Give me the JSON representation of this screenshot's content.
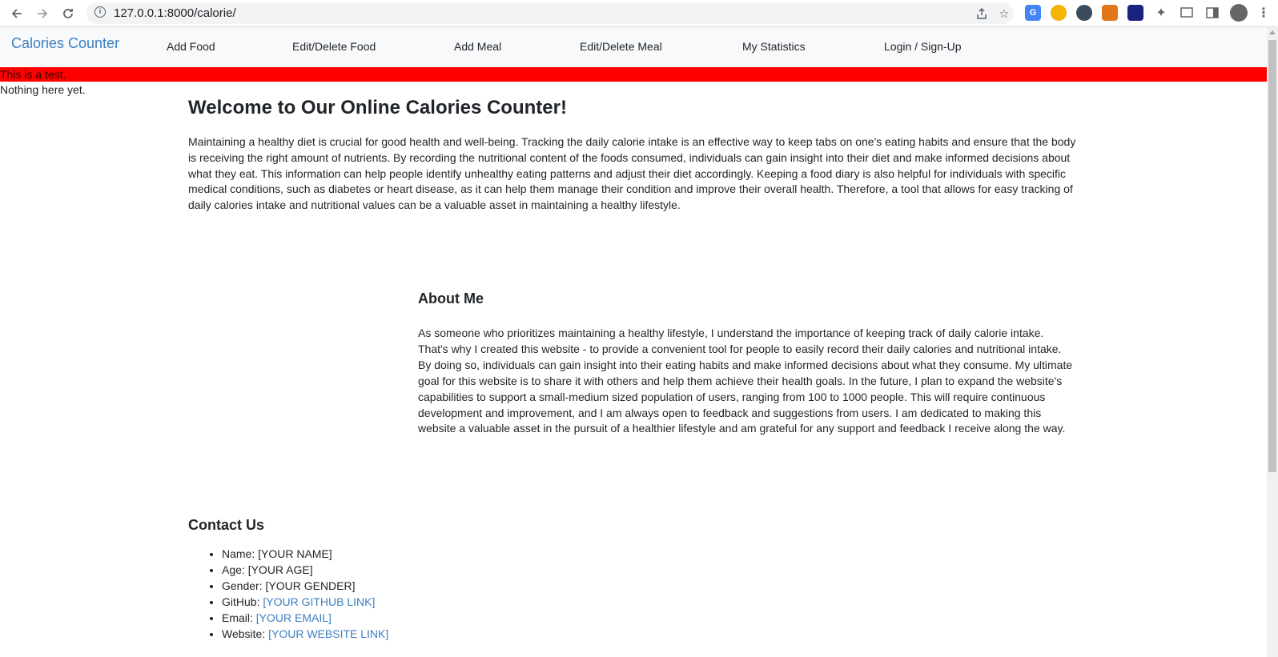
{
  "browser": {
    "url": "127.0.0.1:8000/calorie/",
    "back_icon": "arrow-left-icon",
    "forward_icon": "arrow-right-icon",
    "reload_icon": "reload-icon"
  },
  "navbar": {
    "brand": "Calories Counter",
    "links": [
      {
        "label": "Add Food"
      },
      {
        "label": "Edit/Delete Food"
      },
      {
        "label": "Add Meal"
      },
      {
        "label": "Edit/Delete Meal"
      },
      {
        "label": "My Statistics"
      },
      {
        "label": "Login / Sign-Up"
      }
    ]
  },
  "alert": {
    "text": "This is a test.",
    "color": "#ff0000"
  },
  "empty_message": "Nothing here yet.",
  "welcome": {
    "title": "Welcome to Our Online Calories Counter!",
    "body": "Maintaining a healthy diet is crucial for good health and well-being. Tracking the daily calorie intake is an effective way to keep tabs on one's eating habits and ensure that the body is receiving the right amount of nutrients. By recording the nutritional content of the foods consumed, individuals can gain insight into their diet and make informed decisions about what they eat. This information can help people identify unhealthy eating patterns and adjust their diet accordingly. Keeping a food diary is also helpful for individuals with specific medical conditions, such as diabetes or heart disease, as it can help them manage their condition and improve their overall health. Therefore, a tool that allows for easy tracking of daily calories intake and nutritional values can be a valuable asset in maintaining a healthy lifestyle."
  },
  "about": {
    "title": "About Me",
    "body": "As someone who prioritizes maintaining a healthy lifestyle, I understand the importance of keeping track of daily calorie intake. That's why I created this website - to provide a convenient tool for people to easily record their daily calories and nutritional intake. By doing so, individuals can gain insight into their eating habits and make informed decisions about what they consume. My ultimate goal for this website is to share it with others and help them achieve their health goals. In the future, I plan to expand the website's capabilities to support a small-medium sized population of users, ranging from 100 to 1000 people. This will require continuous development and improvement, and I am always open to feedback and suggestions from users. I am dedicated to making this website a valuable asset in the pursuit of a healthier lifestyle and am grateful for any support and feedback I receive along the way."
  },
  "contact": {
    "title": "Contact Us",
    "items": [
      {
        "label": "Name:",
        "value": "[YOUR NAME]"
      },
      {
        "label": "Age:",
        "value": "[YOUR AGE]"
      },
      {
        "label": "Gender:",
        "value": "[YOUR GENDER]"
      },
      {
        "label": "GitHub:",
        "value": "[YOUR GITHUB LINK]"
      },
      {
        "label": "Email:",
        "value": "[YOUR EMAIL]"
      },
      {
        "label": "Website:",
        "value": "[YOUR WEBSITE LINK]"
      }
    ]
  },
  "colors": {
    "brand": "#3d7fc1",
    "link": "#3d7fc1",
    "navbar_bg": "#f8f9fa"
  }
}
